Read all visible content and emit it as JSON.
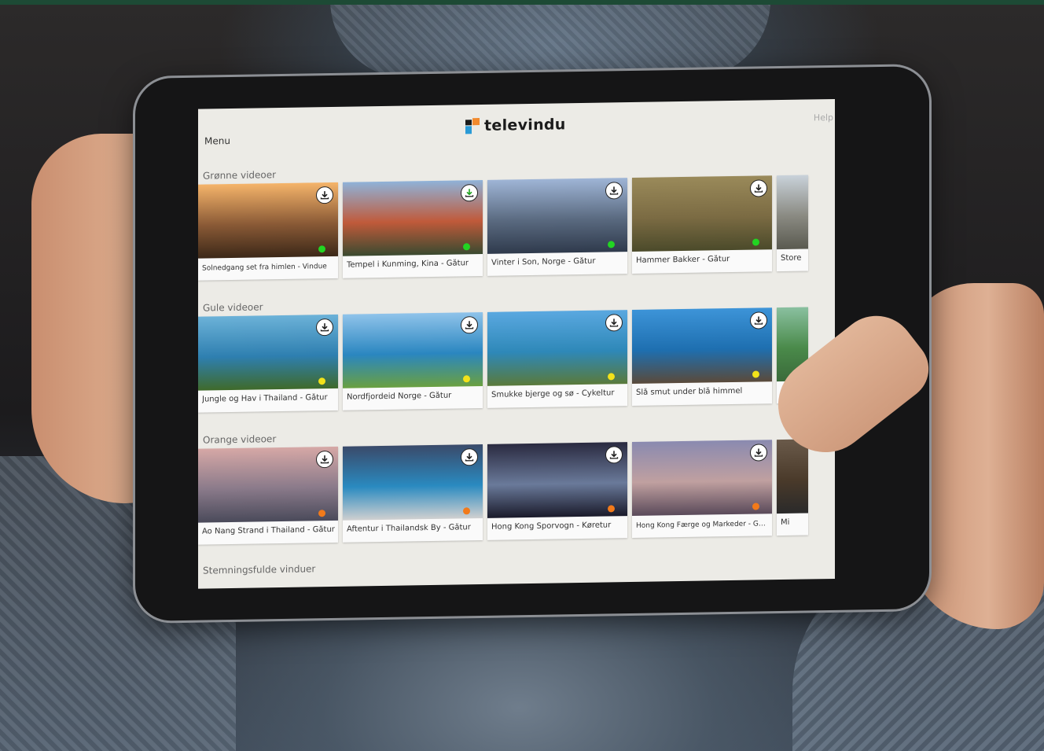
{
  "app": {
    "logo_text": "televindu",
    "menu_label": "Menu",
    "help_label": "Help"
  },
  "sections": [
    {
      "title": "Grønne videoer",
      "dot_color": "#22d422",
      "items": [
        {
          "label": "Solnedgang set fra himlen - Vindue",
          "thumb_colors": [
            "#f5b46a",
            "#8a5a36",
            "#3c2818"
          ]
        },
        {
          "label": "Tempel i Kunming, Kina - Gåtur",
          "thumb_colors": [
            "#8fb2d8",
            "#c05a3a",
            "#3a4a30"
          ],
          "download_icon": "download-done-icon"
        },
        {
          "label": "Vinter i Son, Norge - Gåtur",
          "thumb_colors": [
            "#9fb5d6",
            "#5a6a80",
            "#2f3a4c"
          ]
        },
        {
          "label": "Hammer Bakker - Gåtur",
          "thumb_colors": [
            "#9a8a5a",
            "#7b6b43",
            "#4b4a2a"
          ]
        },
        {
          "label": "Store",
          "thumb_colors": [
            "#c9d2da",
            "#8a8a82",
            "#5a5a50"
          ]
        }
      ]
    },
    {
      "title": "Gule videoer",
      "dot_color": "#f2e21a",
      "items": [
        {
          "label": "Jungle og Hav i Thailand - Gåtur",
          "thumb_colors": [
            "#6cb2d8",
            "#2e7fb0",
            "#3f6a2a"
          ]
        },
        {
          "label": "Nordfjordeid Norge - Gåtur",
          "thumb_colors": [
            "#8fc3ea",
            "#2a86c0",
            "#6aa040"
          ]
        },
        {
          "label": "Smukke bjerge og sø - Cykeltur",
          "thumb_colors": [
            "#5aa8e0",
            "#2e88b8",
            "#5a7a3a"
          ]
        },
        {
          "label": "Slå smut under blå himmel",
          "thumb_colors": [
            "#3d94d8",
            "#1e6fb0",
            "#5a4a3a"
          ]
        },
        {
          "label": "",
          "thumb_colors": [
            "#8ac0a0",
            "#4a8a4a",
            "#3a6a3a"
          ]
        }
      ]
    },
    {
      "title": "Orange videoer",
      "dot_color": "#f27a1a",
      "items": [
        {
          "label": "Ao Nang Strand i Thailand - Gåtur",
          "thumb_colors": [
            "#d6a8a6",
            "#8a7a8a",
            "#4a4a5a"
          ]
        },
        {
          "label": "Aftentur i Thailandsk By - Gåtur",
          "thumb_colors": [
            "#3a4a6a",
            "#2a8ac0",
            "#d0d0d0"
          ]
        },
        {
          "label": "Hong Kong Sporvogn - Køretur",
          "thumb_colors": [
            "#2a2a40",
            "#6a7a9a",
            "#1a1a2a"
          ]
        },
        {
          "label": "Hong Kong Færge og Markeder - Gåt...",
          "thumb_colors": [
            "#8a8ab0",
            "#c0a0a0",
            "#5a4a5a"
          ]
        },
        {
          "label": "Mi",
          "thumb_colors": [
            "#6a5a4a",
            "#4a3a2a",
            "#2a2a2a"
          ]
        }
      ]
    },
    {
      "title": "Stemningsfulde vinduer",
      "items": []
    }
  ]
}
